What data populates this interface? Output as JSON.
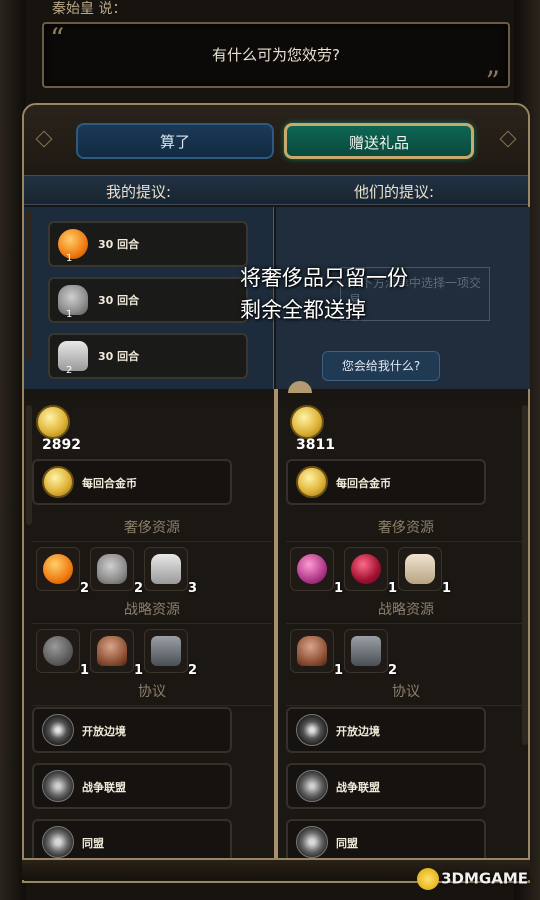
{
  "speaker": "秦始皇 说：",
  "quote": {
    "open_mark": "“",
    "text": "有什么可为您效劳?",
    "close_mark": "”"
  },
  "buttons": {
    "cancel": "算了",
    "gift": "赠送礼品",
    "ask": "您会给我什么?"
  },
  "headers": {
    "my_offer": "我的提议:",
    "their_offer": "他们的提议:"
  },
  "my_offer_items": [
    {
      "label": "30 回合",
      "count": "1",
      "icon": "orange-icon"
    },
    {
      "label": "30 回合",
      "count": "1",
      "icon": "elephant-icon"
    },
    {
      "label": "30 回合",
      "count": "2",
      "icon": "salt-icon"
    }
  ],
  "their_offer_hint": "从下方清单中选择一项交易。",
  "overlay_text": [
    "将奢侈品只留一份",
    "剩余全都送掉"
  ],
  "left_column": {
    "gold": "2892",
    "gold_per_turn": "每回合金币",
    "luxury_title": "奢侈资源",
    "luxury": [
      {
        "icon": "orange-icon",
        "count": "2"
      },
      {
        "icon": "elephant-icon",
        "count": "2"
      },
      {
        "icon": "salt-icon",
        "count": "3"
      }
    ],
    "strategic_title": "战略资源",
    "strategic": [
      {
        "icon": "stone-icon",
        "count": "1"
      },
      {
        "icon": "horse-icon",
        "count": "1"
      },
      {
        "icon": "iron-icon",
        "count": "2"
      }
    ],
    "agreements_title": "协议",
    "agreements": [
      "开放边境",
      "战争联盟",
      "同盟"
    ]
  },
  "right_column": {
    "gold": "3811",
    "gold_per_turn": "每回合金币",
    "luxury_title": "奢侈资源",
    "luxury": [
      {
        "icon": "perfume-icon",
        "count": "1"
      },
      {
        "icon": "silk-icon",
        "count": "1"
      },
      {
        "icon": "ivory-icon",
        "count": "1"
      }
    ],
    "strategic_title": "战略资源",
    "strategic": [
      {
        "icon": "horse-icon",
        "count": "1"
      },
      {
        "icon": "iron-icon",
        "count": "2"
      }
    ],
    "agreements_title": "协议",
    "agreements": [
      "开放边境",
      "战争联盟",
      "同盟"
    ]
  },
  "watermark": "3DMGAME"
}
